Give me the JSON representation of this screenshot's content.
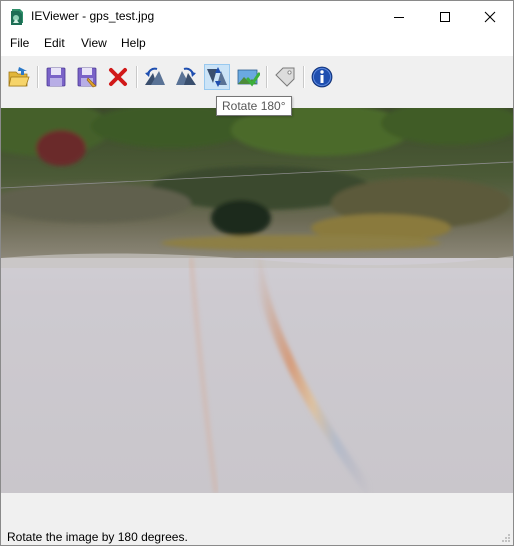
{
  "window": {
    "title": "IEViewer - gps_test.jpg",
    "controls": {
      "minimize": "minimize",
      "maximize": "maximize",
      "close": "close"
    }
  },
  "menubar": {
    "items": [
      {
        "label": "File"
      },
      {
        "label": "Edit"
      },
      {
        "label": "View"
      },
      {
        "label": "Help"
      }
    ]
  },
  "toolbar": {
    "buttons": [
      {
        "icon": "open-folder-icon"
      },
      {
        "icon": "save-icon"
      },
      {
        "icon": "save-as-icon"
      },
      {
        "icon": "delete-icon"
      },
      {
        "icon": "rotate-left-icon"
      },
      {
        "icon": "rotate-right-icon"
      },
      {
        "icon": "rotate-180-icon",
        "state": "hovered"
      },
      {
        "icon": "apply-image-icon"
      },
      {
        "icon": "tag-icon"
      },
      {
        "icon": "info-icon"
      }
    ],
    "tooltip": "Rotate 180°"
  },
  "image": {
    "filename": "gps_test.jpg",
    "orientation": "upside-down"
  },
  "statusbar": {
    "text": "Rotate the image by 180 degrees."
  },
  "colors": {
    "accent": "#cce4f7",
    "info": "#1f4fb0",
    "delete": "#d11818"
  }
}
